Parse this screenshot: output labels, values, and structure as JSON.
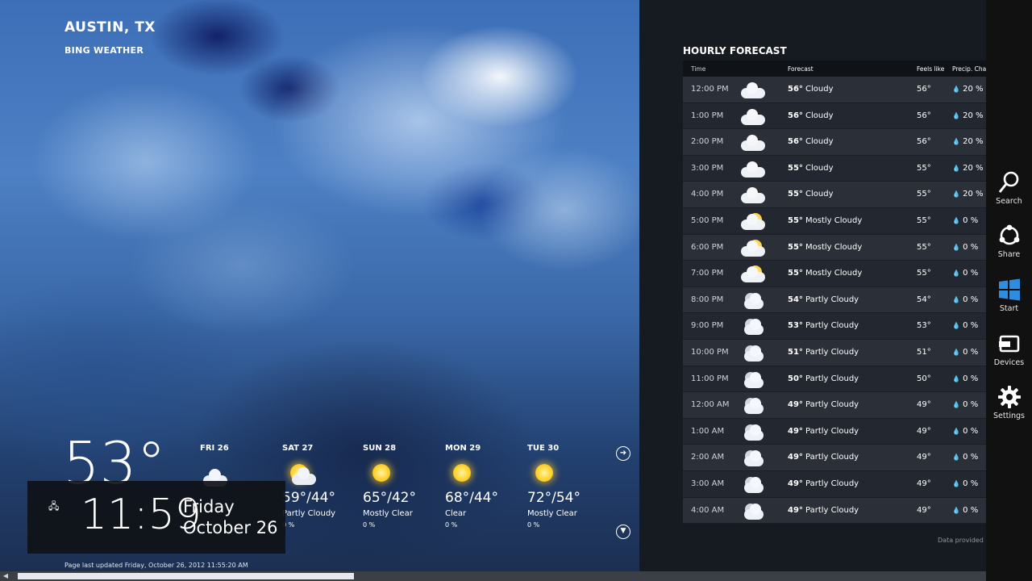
{
  "location": {
    "city": "AUSTIN, TX",
    "app_name": "BING WEATHER"
  },
  "current": {
    "temp": "53°"
  },
  "daily": [
    {
      "day": "FRI 26",
      "icon": "cloudy-icon",
      "temp": "",
      "condition": "",
      "precip": ""
    },
    {
      "day": "SAT 27",
      "icon": "partly-cloudy-icon",
      "temp": "59°/44°",
      "condition": "Partly Cloudy",
      "precip": "0 %"
    },
    {
      "day": "SUN 28",
      "icon": "sun-icon",
      "temp": "65°/42°",
      "condition": "Mostly Clear",
      "precip": "0 %"
    },
    {
      "day": "MON 29",
      "icon": "sun-icon",
      "temp": "68°/44°",
      "condition": "Clear",
      "precip": "0 %"
    },
    {
      "day": "TUE 30",
      "icon": "sun-icon",
      "temp": "72°/54°",
      "condition": "Mostly Clear",
      "precip": "0 %"
    }
  ],
  "updated_text": "Page last updated Friday, October 26, 2012 11:55:20 AM",
  "clock": {
    "time": "11:59",
    "day": "Friday",
    "date": "October 26"
  },
  "hourly": {
    "title": "HOURLY FORECAST",
    "headers": {
      "time": "Time",
      "forecast": "Forecast",
      "feels": "Feels like",
      "precip": "Precip. Chance"
    },
    "rows": [
      {
        "time": "12:00 PM",
        "icon": "cloudy",
        "temp": "56°",
        "cond": "Cloudy",
        "feels": "56°",
        "precip": "20 %"
      },
      {
        "time": "1:00 PM",
        "icon": "cloudy",
        "temp": "56°",
        "cond": "Cloudy",
        "feels": "56°",
        "precip": "20 %"
      },
      {
        "time": "2:00 PM",
        "icon": "cloudy",
        "temp": "56°",
        "cond": "Cloudy",
        "feels": "56°",
        "precip": "20 %"
      },
      {
        "time": "3:00 PM",
        "icon": "cloudy",
        "temp": "55°",
        "cond": "Cloudy",
        "feels": "55°",
        "precip": "20 %"
      },
      {
        "time": "4:00 PM",
        "icon": "cloudy",
        "temp": "55°",
        "cond": "Cloudy",
        "feels": "55°",
        "precip": "20 %"
      },
      {
        "time": "5:00 PM",
        "icon": "mostly-cloudy",
        "temp": "55°",
        "cond": "Mostly Cloudy",
        "feels": "55°",
        "precip": "0 %"
      },
      {
        "time": "6:00 PM",
        "icon": "mostly-cloudy",
        "temp": "55°",
        "cond": "Mostly Cloudy",
        "feels": "55°",
        "precip": "0 %"
      },
      {
        "time": "7:00 PM",
        "icon": "mostly-cloudy",
        "temp": "55°",
        "cond": "Mostly Cloudy",
        "feels": "55°",
        "precip": "0 %"
      },
      {
        "time": "8:00 PM",
        "icon": "partly-cloudy-night",
        "temp": "54°",
        "cond": "Partly Cloudy",
        "feels": "54°",
        "precip": "0 %"
      },
      {
        "time": "9:00 PM",
        "icon": "partly-cloudy-night",
        "temp": "53°",
        "cond": "Partly Cloudy",
        "feels": "53°",
        "precip": "0 %"
      },
      {
        "time": "10:00 PM",
        "icon": "partly-cloudy-night",
        "temp": "51°",
        "cond": "Partly Cloudy",
        "feels": "51°",
        "precip": "0 %"
      },
      {
        "time": "11:00 PM",
        "icon": "partly-cloudy-night",
        "temp": "50°",
        "cond": "Partly Cloudy",
        "feels": "50°",
        "precip": "0 %"
      },
      {
        "time": "12:00 AM",
        "icon": "partly-cloudy-night",
        "temp": "49°",
        "cond": "Partly Cloudy",
        "feels": "49°",
        "precip": "0 %"
      },
      {
        "time": "1:00 AM",
        "icon": "partly-cloudy-night",
        "temp": "49°",
        "cond": "Partly Cloudy",
        "feels": "49°",
        "precip": "0 %"
      },
      {
        "time": "2:00 AM",
        "icon": "partly-cloudy-night",
        "temp": "49°",
        "cond": "Partly Cloudy",
        "feels": "49°",
        "precip": "0 %"
      },
      {
        "time": "3:00 AM",
        "icon": "partly-cloudy-night",
        "temp": "49°",
        "cond": "Partly Cloudy",
        "feels": "49°",
        "precip": "0 %"
      },
      {
        "time": "4:00 AM",
        "icon": "partly-cloudy-night",
        "temp": "49°",
        "cond": "Partly Cloudy",
        "feels": "49°",
        "precip": "0 %"
      }
    ],
    "data_provided": "Data provided b"
  },
  "charms": [
    {
      "label": "Search",
      "icon": "search-icon"
    },
    {
      "label": "Share",
      "icon": "share-icon"
    },
    {
      "label": "Start",
      "icon": "windows-icon"
    },
    {
      "label": "Devices",
      "icon": "devices-icon"
    },
    {
      "label": "Settings",
      "icon": "gear-icon"
    }
  ],
  "colors": {
    "panel": "#161a21",
    "row_odd": "#2a2f38",
    "row_even": "#232830",
    "charms_bg": "#111111",
    "start_blue": "#2e8de0"
  }
}
